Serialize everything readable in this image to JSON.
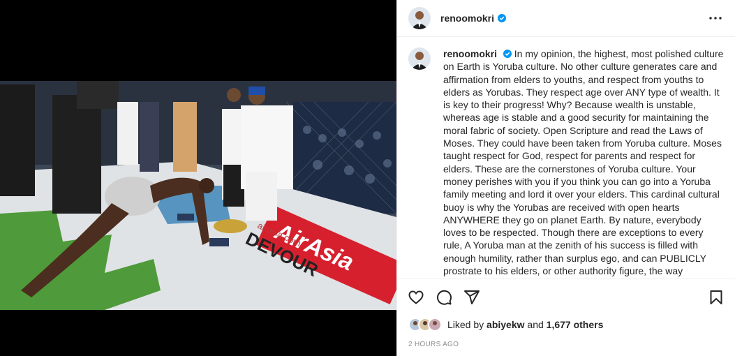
{
  "post": {
    "username": "renoomokri",
    "caption": "In my opinion, the highest, most polished culture on Earth is Yoruba culture. No other culture generates care and affirmation from elders to youths, and respect from youths to elders as Yorubas. They respect age over ANY type of wealth. It is key to their progress! Why? Because wealth is unstable, whereas age is stable and a good security for maintaining the moral fabric of society. Open Scripture and read the Laws of Moses. They could have been taken from Yoruba culture. Moses taught respect for God, respect for parents and respect for elders. These are the cornerstones of Yoruba culture. Your money perishes with you if you think you can go into a Yoruba family meeting and lord it over your elders. This cardinal cultural buoy is why the Yorubas are received with open hearts ANYWHERE they go on planet Earth. By nature, everybody loves to be respected. Though there are exceptions to every rule, A Yoruba man at the zenith of his success is filled with enough humility, rather than surplus ego, and can PUBLICLY prostrate to his elders, or other authority figure, the way President Obasanjo prostrated FLAT to the Olowu",
    "likes_prefix": "Liked by ",
    "liked_by": "abiyekw",
    "likes_conj": " and ",
    "likes_count": "1,677 others",
    "timestamp": "2 HOURS AGO"
  },
  "photo": {
    "banner_text": "AirAsia",
    "banner_url": "airasia.com",
    "floor_text": "DEVOUR"
  },
  "icons": {
    "verified": "verified-badge-icon",
    "more": "more-options-icon",
    "like": "heart-icon",
    "comment": "comment-icon",
    "share": "share-icon",
    "save": "bookmark-icon"
  },
  "colors": {
    "verified_blue": "#0095f6",
    "secondary_text": "#8e8e8e",
    "banner_red": "#d6202e"
  }
}
